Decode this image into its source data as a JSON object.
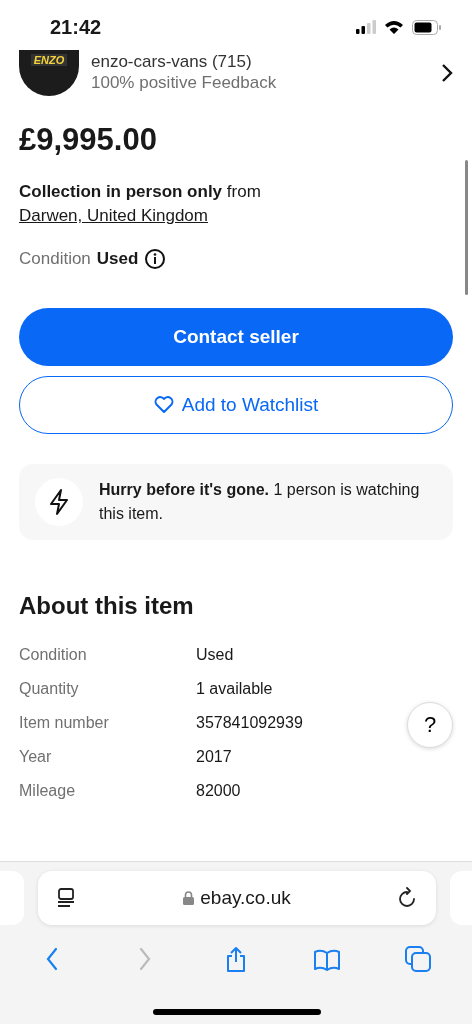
{
  "status_bar": {
    "time": "21:42"
  },
  "seller": {
    "logo": "ENZO",
    "name": "enzo-cars-vans (715)",
    "feedback": "100% positive Feedback"
  },
  "price": "£9,995.00",
  "collection": {
    "text": "**Collection in person only** from ",
    "link": "Darwen, United Kingdom"
  },
  "condition": {
    "label": "Condition",
    "value": "Used"
  },
  "buttons": [
    {
      "kind": "primary",
      "label": "Contact seller"
    },
    {
      "kind": "watch",
      "label": "Add to Watchlist"
    }
  ],
  "notice": "**Hurry before it's gone.** 1 person is watching this item.",
  "about": {
    "title": "About this item",
    "rows": [
      {
        "label": "Condition",
        "value": "Used"
      },
      {
        "label": "Quantity",
        "value": "1 available"
      },
      {
        "label": "Item number",
        "value": "357841092939"
      },
      {
        "label": "Year",
        "value": "2017"
      },
      {
        "label": "Mileage",
        "value": "82000"
      }
    ]
  },
  "help": "?",
  "browser": {
    "url": "ebay.co.uk",
    "toolbar": [
      {
        "kind": "back",
        "disabled": false
      },
      {
        "kind": "forward",
        "disabled": true
      },
      {
        "kind": "share",
        "disabled": false
      },
      {
        "kind": "bookmarks",
        "disabled": false
      },
      {
        "kind": "tabs",
        "disabled": false
      }
    ]
  }
}
